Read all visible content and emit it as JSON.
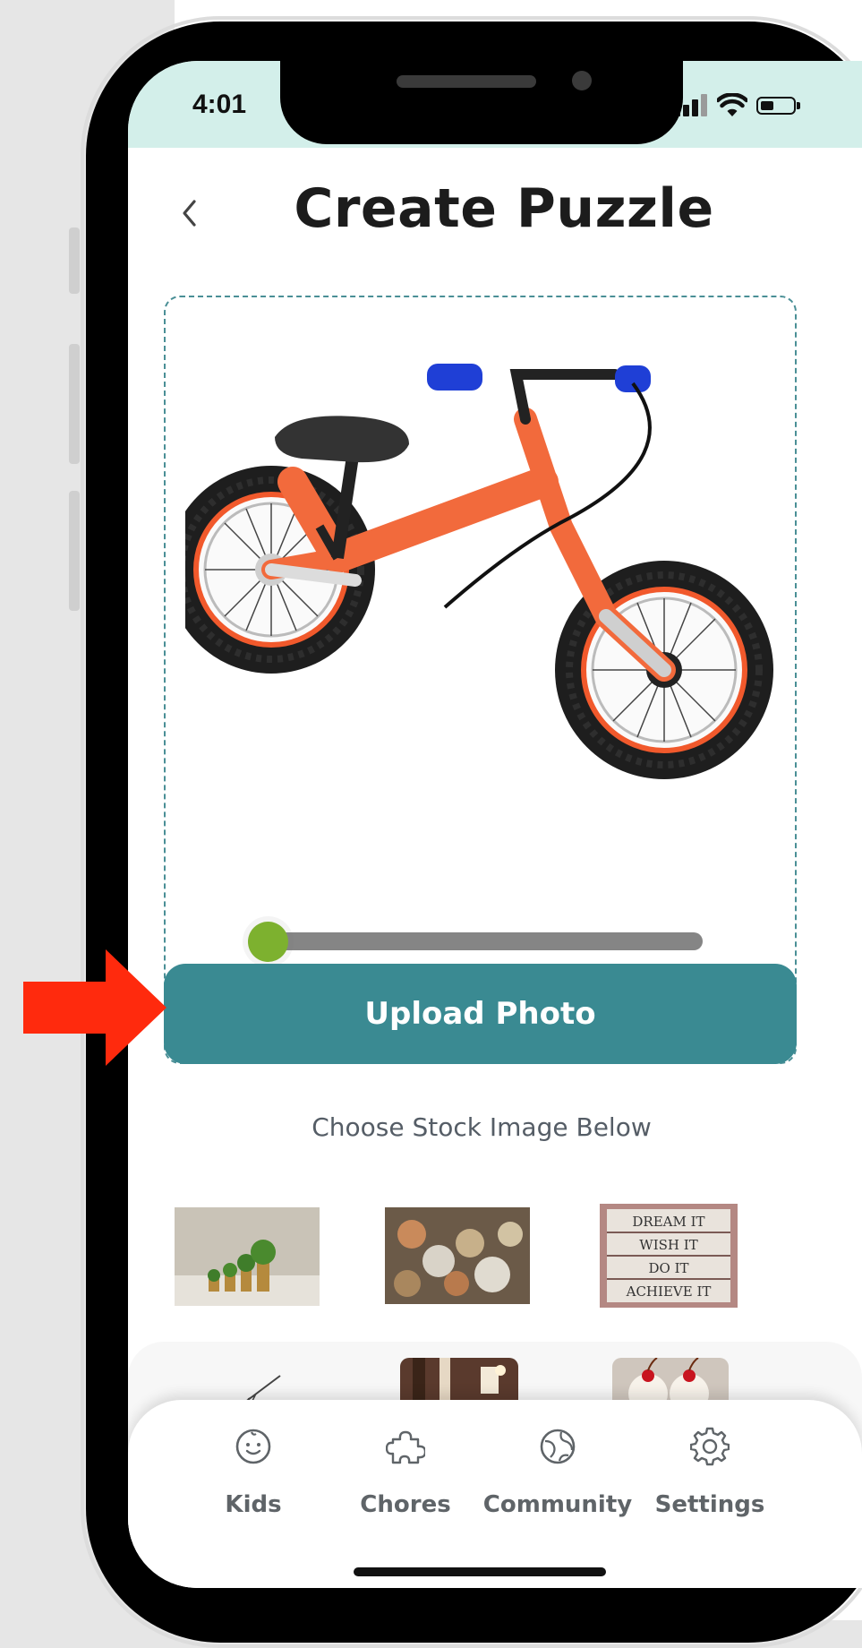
{
  "status_bar": {
    "time": "4:01"
  },
  "header": {
    "title": "Create Puzzle"
  },
  "upload": {
    "button_label": "Upload Photo",
    "zoom_level": 0.0
  },
  "stock": {
    "heading": "Choose Stock Image Below",
    "images": [
      {
        "name": "coin-stacks-plants"
      },
      {
        "name": "coins-pile"
      },
      {
        "name": "dream-it-board",
        "lines": [
          "DREAM IT",
          "WISH IT",
          "DO IT",
          "ACHIEVE IT"
        ]
      }
    ]
  },
  "bottom_nav": {
    "items": [
      {
        "label": "Kids",
        "icon": "smiley-icon"
      },
      {
        "label": "Chores",
        "icon": "puzzle-piece-icon"
      },
      {
        "label": "Community",
        "icon": "globe-icon"
      },
      {
        "label": "Settings",
        "icon": "gear-icon"
      }
    ]
  },
  "colors": {
    "status_bar": "#d3efea",
    "primary": "#3a8a92",
    "slider_thumb": "#7db12f",
    "annotation_arrow": "#ff2a0d"
  }
}
